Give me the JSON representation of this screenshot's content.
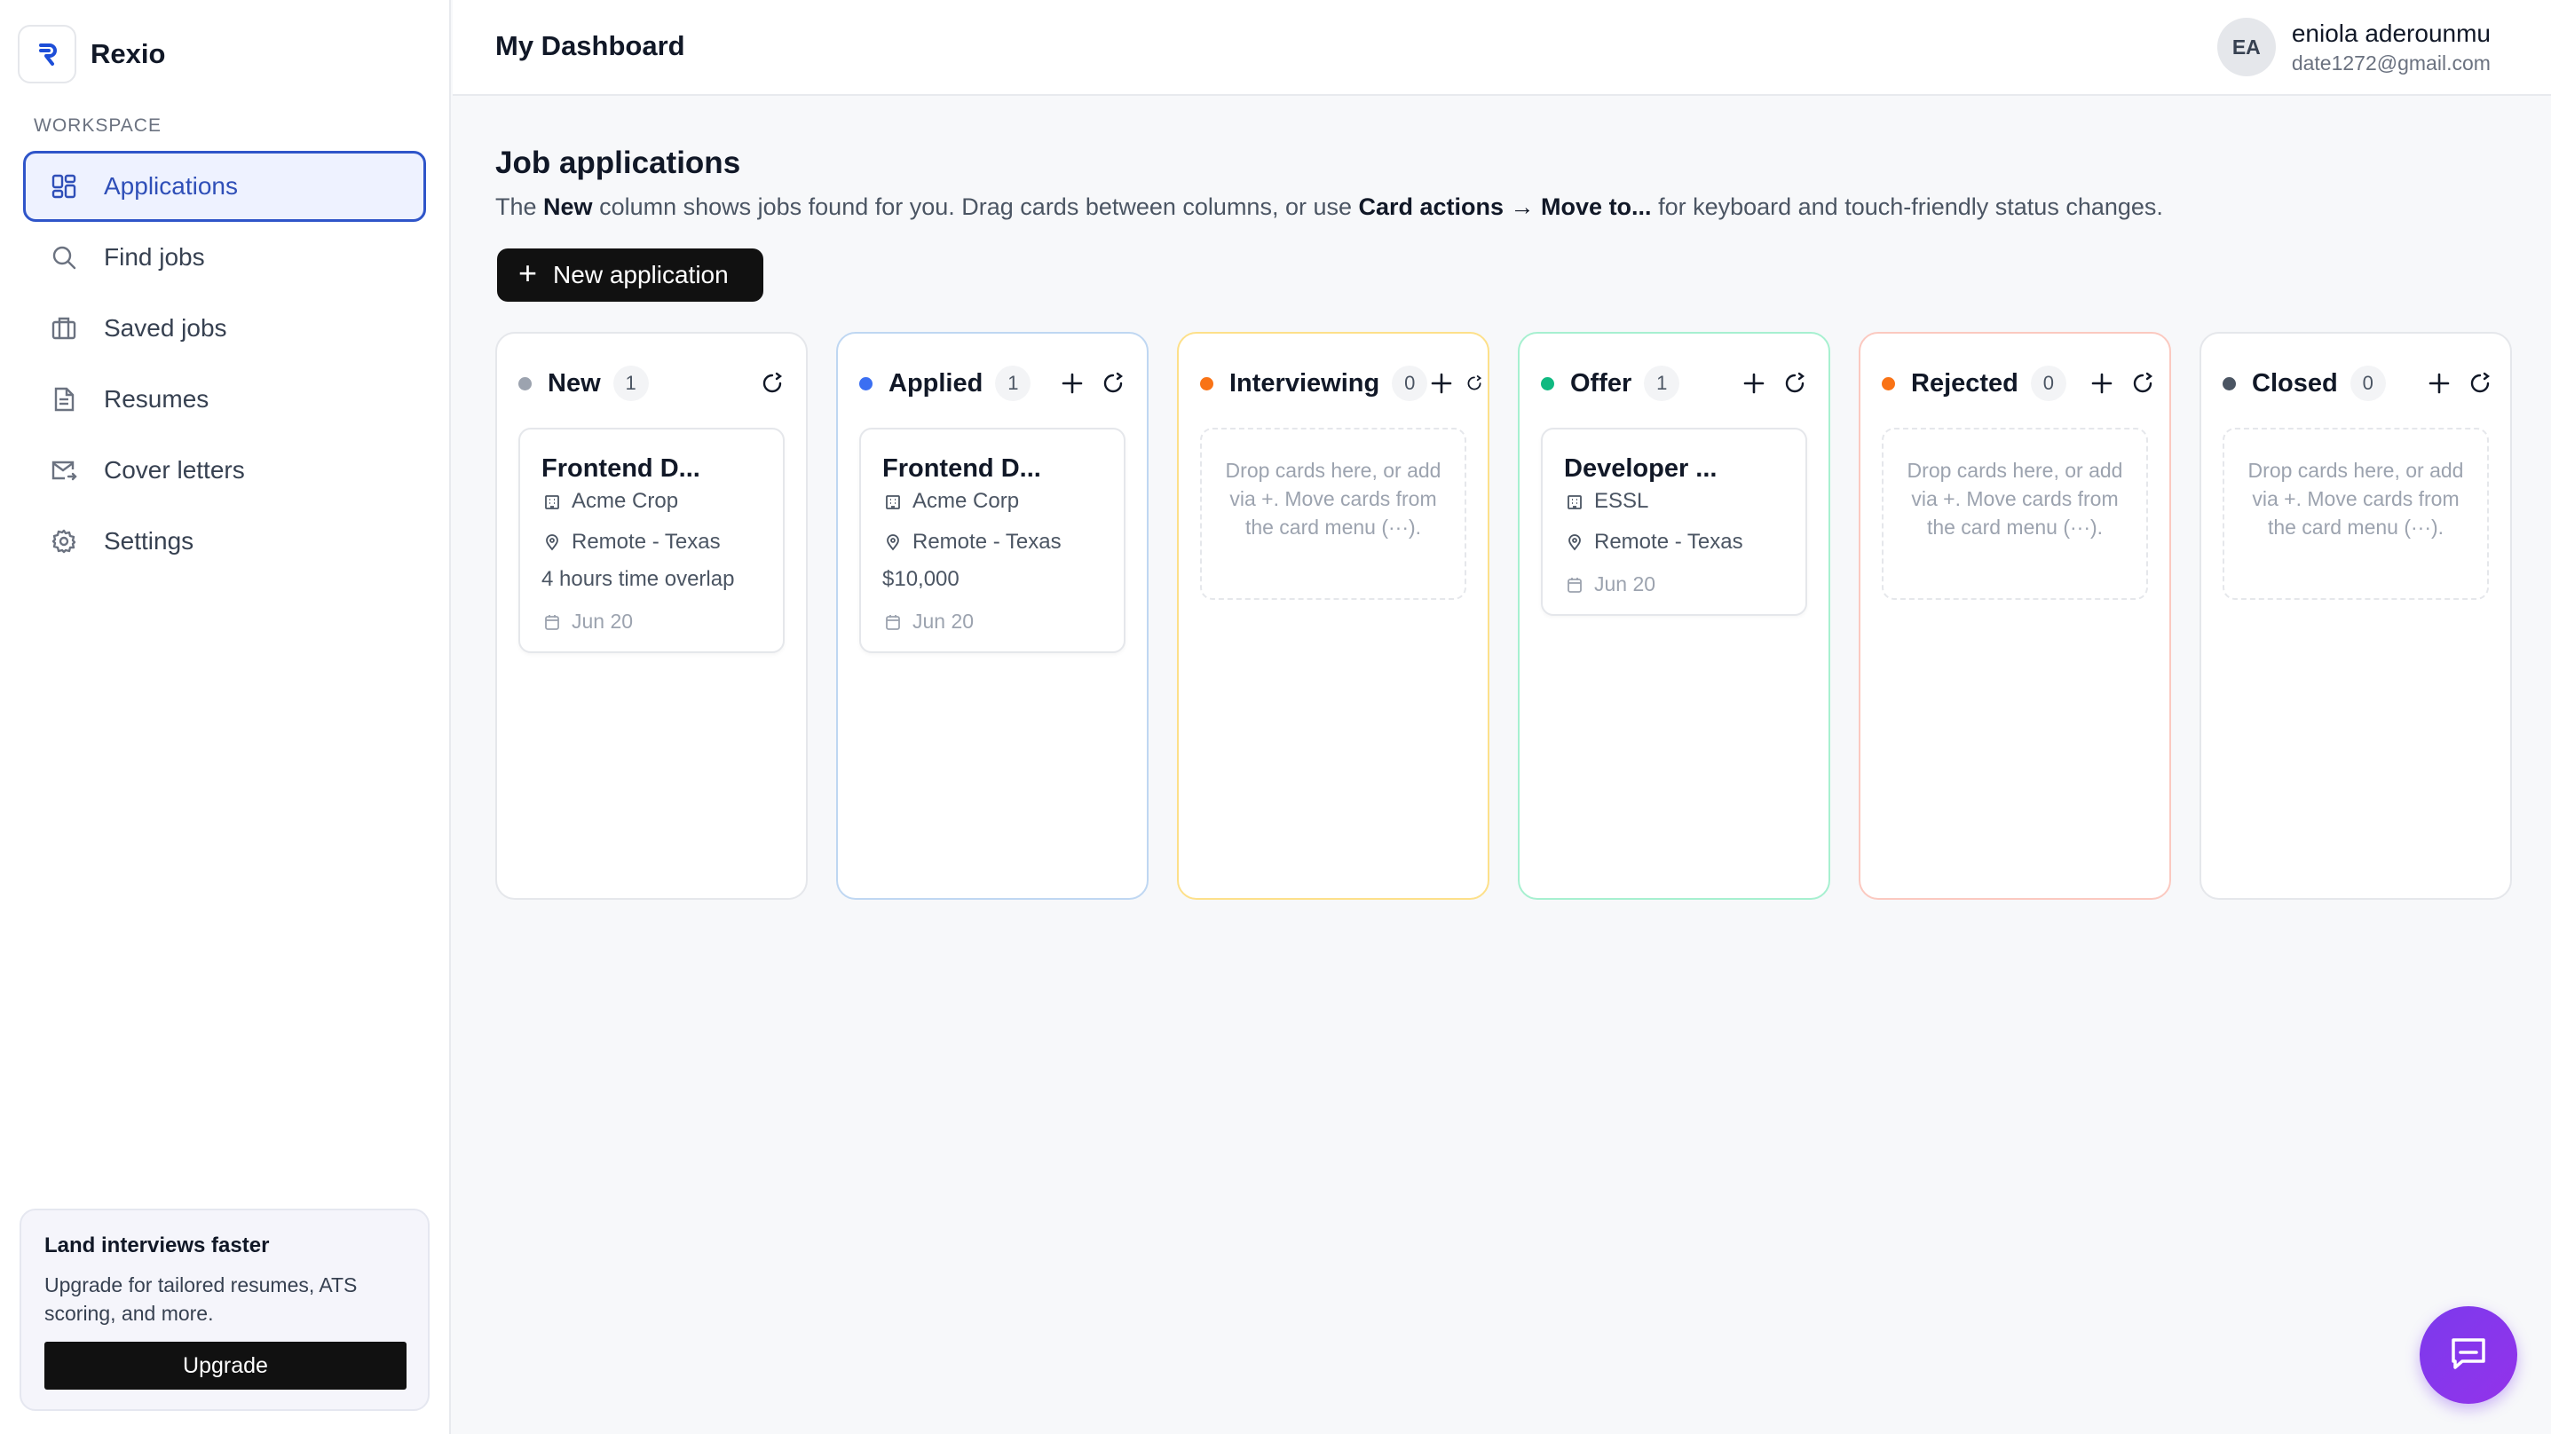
{
  "brand": {
    "name": "Rexio"
  },
  "sidebar": {
    "section_label": "WORKSPACE",
    "items": [
      {
        "label": "Applications",
        "icon": "grid-icon",
        "active": true
      },
      {
        "label": "Find jobs",
        "icon": "search-icon",
        "active": false
      },
      {
        "label": "Saved jobs",
        "icon": "briefcase-icon",
        "active": false
      },
      {
        "label": "Resumes",
        "icon": "document-icon",
        "active": false
      },
      {
        "label": "Cover letters",
        "icon": "mail-icon",
        "active": false
      },
      {
        "label": "Settings",
        "icon": "gear-icon",
        "active": false
      }
    ],
    "promo": {
      "title": "Land interviews faster",
      "text": "Upgrade for tailored resumes, ATS scoring, and more.",
      "button": "Upgrade"
    }
  },
  "header": {
    "title": "My Dashboard",
    "user": {
      "initials": "EA",
      "name": "eniola aderounmu",
      "email": "date1272@gmail.com"
    }
  },
  "main": {
    "title": "Job applications",
    "desc": {
      "p1": "The ",
      "b1": "New",
      "p2": " column shows jobs found for you. Drag cards between columns, or use ",
      "b2": "Card actions → Move to...",
      "p3": " for keyboard and touch-friendly status changes."
    },
    "new_button": "New application"
  },
  "columns": [
    {
      "title": "New",
      "count": "1",
      "dot": "#9ca3af",
      "border": "#e5e7eb"
    },
    {
      "title": "Applied",
      "count": "1",
      "dot": "#3b6ff2",
      "border": "#bfd7f2"
    },
    {
      "title": "Interviewing",
      "count": "0",
      "dot": "#f97316",
      "border": "#fde08a"
    },
    {
      "title": "Offer",
      "count": "1",
      "dot": "#10b981",
      "border": "#a7f0d0"
    },
    {
      "title": "Rejected",
      "count": "0",
      "dot": "#f97316",
      "border": "#fbc9c0"
    },
    {
      "title": "Closed",
      "count": "0",
      "dot": "#4b5563",
      "border": "#e5e7eb"
    }
  ],
  "cards": {
    "new": {
      "title": "Frontend D...",
      "company": "Acme Crop",
      "location": "Remote - Texas",
      "extra": "4 hours time overlap",
      "date": "Jun 20"
    },
    "applied": {
      "title": "Frontend D...",
      "company": "Acme Corp",
      "location": "Remote - Texas",
      "extra": "$10,000",
      "date": "Jun 20"
    },
    "offer": {
      "title": "Developer ...",
      "company": "ESSL",
      "location": "Remote - Texas",
      "date": "Jun 20"
    }
  },
  "drop_text": "Drop cards here, or add via +. Move cards from the card menu (···)."
}
